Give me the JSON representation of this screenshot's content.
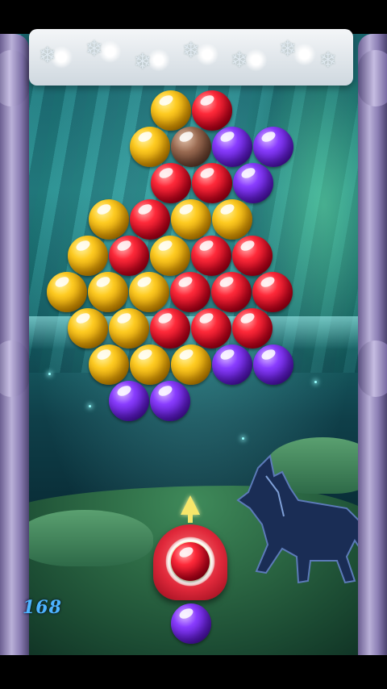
{
  "score": "168",
  "colors": {
    "yellow": "#ffcc22",
    "red": "#ff2a3a",
    "purple": "#8a3dff",
    "brown": "#9b6b52"
  },
  "bubble_grid": [
    {
      "row": 0,
      "cells": [
        "yellow",
        "red"
      ]
    },
    {
      "row": 1,
      "cells": [
        "yellow",
        "brown",
        "purple",
        "purple"
      ]
    },
    {
      "row": 2,
      "cells": [
        "red",
        "red",
        "purple"
      ]
    },
    {
      "row": 3,
      "cells": [
        "yellow",
        "red",
        "yellow",
        "yellow"
      ]
    },
    {
      "row": 4,
      "cells": [
        "yellow",
        "red",
        "yellow",
        "red",
        "red"
      ]
    },
    {
      "row": 5,
      "cells": [
        "yellow",
        "yellow",
        "yellow",
        "red",
        "red",
        "red"
      ]
    },
    {
      "row": 6,
      "cells": [
        "yellow",
        "yellow",
        "red",
        "red",
        "red"
      ]
    },
    {
      "row": 7,
      "cells": [
        "yellow",
        "yellow",
        "yellow",
        "purple",
        "purple"
      ]
    },
    {
      "row": 8,
      "cells": [
        "purple",
        "purple"
      ]
    }
  ],
  "shooter": {
    "loaded_color": "red",
    "next_color": "purple"
  },
  "icons": [
    "snowflake-icon",
    "aim-arrow-icon"
  ]
}
